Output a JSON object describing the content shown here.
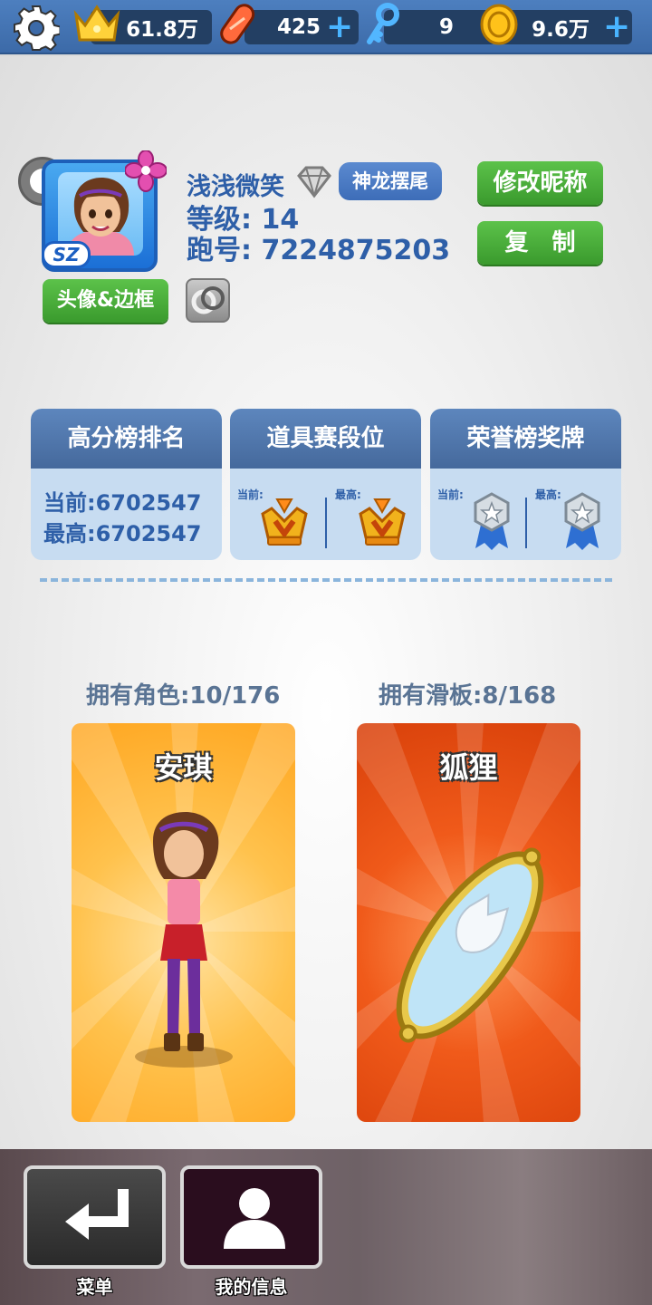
{
  "currency": {
    "trophies": "61.8万",
    "hoverboards": "425",
    "keys": "9",
    "coins": "9.6万"
  },
  "profile": {
    "nickname": "浅浅微笑",
    "title_badge": "神龙摆尾",
    "level_text": "等级: 14",
    "runner_id_text": "跑号: 7224875203",
    "avatar_badge": "SZ",
    "avatar_frame_button": "头像&边框",
    "rename_button": "修改昵称",
    "copy_button": "复　制"
  },
  "stats": {
    "highscore": {
      "title": "高分榜排名",
      "current": "当前:6702547",
      "best": "最高:6702547"
    },
    "item_league": {
      "title": "道具赛段位",
      "current_label": "当前:",
      "best_label": "最高:"
    },
    "honor_medal": {
      "title": "荣誉榜奖牌",
      "current_label": "当前:",
      "best_label": "最高:"
    }
  },
  "collection": {
    "characters_label": "拥有角色:10/176",
    "boards_label": "拥有滑板:8/168",
    "character_name": "安琪",
    "board_name": "狐狸"
  },
  "nav": {
    "menu_label": "菜单",
    "my_info_label": "我的信息"
  },
  "colors": {
    "topbar": "#4d7fbf",
    "accent_blue": "#2e5fa8",
    "green_button": "#4cb23c",
    "character_card": "#ffb22e",
    "board_card": "#e3400a"
  }
}
